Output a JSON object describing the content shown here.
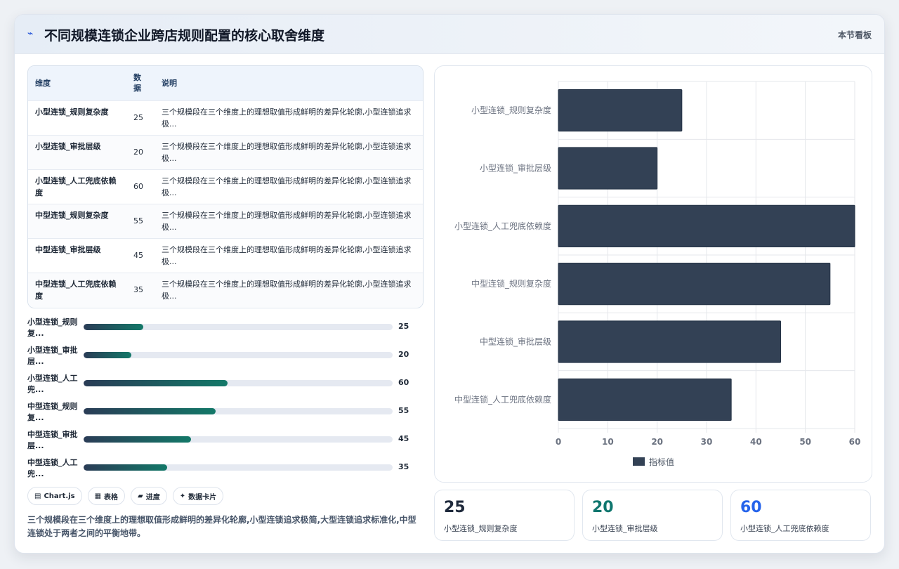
{
  "header": {
    "icon": "trend-icon",
    "title": "不同规模连锁企业跨店规则配置的核心取舍维度",
    "tag": "本节看板"
  },
  "table": {
    "columns": [
      "维度",
      "数据",
      "说明"
    ],
    "rows": [
      {
        "dim": "小型连锁_规则复杂度",
        "value": "25",
        "desc": "三个规模段在三个维度上的理想取值形成鲜明的差异化轮廓,小型连锁追求极..."
      },
      {
        "dim": "小型连锁_审批层级",
        "value": "20",
        "desc": "三个规模段在三个维度上的理想取值形成鲜明的差异化轮廓,小型连锁追求极..."
      },
      {
        "dim": "小型连锁_人工兜底依赖度",
        "value": "60",
        "desc": "三个规模段在三个维度上的理想取值形成鲜明的差异化轮廓,小型连锁追求极..."
      },
      {
        "dim": "中型连锁_规则复杂度",
        "value": "55",
        "desc": "三个规模段在三个维度上的理想取值形成鲜明的差异化轮廓,小型连锁追求极..."
      },
      {
        "dim": "中型连锁_审批层级",
        "value": "45",
        "desc": "三个规模段在三个维度上的理想取值形成鲜明的差异化轮廓,小型连锁追求极..."
      },
      {
        "dim": "中型连锁_人工兜底依赖度",
        "value": "35",
        "desc": "三个规模段在三个维度上的理想取值形成鲜明的差异化轮廓,小型连锁追求极..."
      }
    ]
  },
  "progress": [
    {
      "label": "小型连锁_规则复...",
      "value": 25,
      "display": "25"
    },
    {
      "label": "小型连锁_审批层...",
      "value": 20,
      "display": "20"
    },
    {
      "label": "小型连锁_人工兜...",
      "value": 60,
      "display": "60"
    },
    {
      "label": "中型连锁_规则复...",
      "value": 55,
      "display": "55"
    },
    {
      "label": "中型连锁_审批层...",
      "value": 45,
      "display": "45"
    },
    {
      "label": "中型连锁_人工兜...",
      "value": 35,
      "display": "35"
    }
  ],
  "progress_max": 129,
  "chips": [
    {
      "icon": "chart-icon",
      "glyph": "▤",
      "label": "Chart.js"
    },
    {
      "icon": "table-icon",
      "glyph": "▦",
      "label": "表格"
    },
    {
      "icon": "progress-icon",
      "glyph": "▰",
      "label": "进度"
    },
    {
      "icon": "card-icon",
      "glyph": "✦",
      "label": "数据卡片"
    }
  ],
  "summary": "三个规模段在三个维度上的理想取值形成鲜明的差异化轮廓,小型连锁追求极简,大型连锁追求标准化,中型连锁处于两者之间的平衡地带。",
  "chart_data": {
    "type": "bar",
    "orientation": "horizontal",
    "categories": [
      "小型连锁_规则复杂度",
      "小型连锁_审批层级",
      "小型连锁_人工兜底依赖度",
      "中型连锁_规则复杂度",
      "中型连锁_审批层级",
      "中型连锁_人工兜底依赖度"
    ],
    "series": [
      {
        "name": "指标值",
        "values": [
          25,
          20,
          60,
          55,
          45,
          35
        ],
        "color": "#334155"
      }
    ],
    "xlim": [
      0,
      60
    ],
    "xticks": [
      0,
      10,
      20,
      30,
      40,
      50,
      60
    ],
    "grid": true,
    "legend": "bottom"
  },
  "kpis": [
    {
      "value": "25",
      "label": "小型连锁_规则复杂度",
      "color": "#1e293b"
    },
    {
      "value": "20",
      "label": "小型连锁_审批层级",
      "color": "#0f766e"
    },
    {
      "value": "60",
      "label": "小型连锁_人工兜底依赖度",
      "color": "#2563eb"
    }
  ]
}
